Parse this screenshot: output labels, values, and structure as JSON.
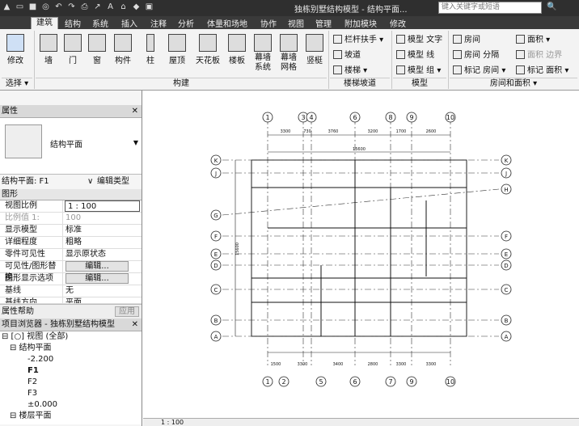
{
  "window": {
    "title": "独栋别墅结构模型 - 结构平面...",
    "search_placeholder": "键入关键字或短语"
  },
  "tabs": [
    "建筑",
    "结构",
    "系统",
    "插入",
    "注释",
    "分析",
    "体量和场地",
    "协作",
    "视图",
    "管理",
    "附加模块",
    "修改"
  ],
  "ribbon": {
    "modify": "修改",
    "select": "选择 ▾",
    "build": [
      "墙",
      "门",
      "窗",
      "构件",
      "柱",
      "屋顶",
      "天花板",
      "楼板",
      "幕墙系统",
      "幕墙网格",
      "竖梃"
    ],
    "build_group": "构建",
    "circ": [
      "栏杆扶手 ▾",
      "坡道",
      "楼梯 ▾"
    ],
    "circ_group": "楼梯坡道",
    "model": [
      "模型 文字",
      "模型 线",
      "模型 组 ▾"
    ],
    "model_group": "模型",
    "room": [
      "房间",
      "房间 分隔",
      "标记 房间 ▾",
      "面积 ▾",
      "面积 边界",
      "标记 面积 ▾"
    ],
    "room_group": "房间和面积 ▾"
  },
  "properties": {
    "header": "属性",
    "type_name": "结构平面",
    "selector": "结构平面: F1",
    "edit_type": "编辑类型",
    "section": "图形",
    "rows": [
      {
        "k": "视图比例",
        "v": "1 : 100"
      },
      {
        "k": "比例值 1:",
        "v": "100"
      },
      {
        "k": "显示模型",
        "v": "标准"
      },
      {
        "k": "详细程度",
        "v": "粗略"
      },
      {
        "k": "零件可见性",
        "v": "显示原状态"
      },
      {
        "k": "可见性/图形替换",
        "v": "编辑..."
      },
      {
        "k": "图形显示选项",
        "v": "编辑..."
      },
      {
        "k": "基线",
        "v": "无"
      },
      {
        "k": "基线方向",
        "v": "平面"
      }
    ],
    "help": "属性帮助",
    "apply": "应用"
  },
  "browser": {
    "header": "项目浏览器 - 独栋别墅结构模型",
    "items": [
      "⊟ [○] 视图 (全部)",
      "⊟ 结构平面",
      "-2.200",
      "F1",
      "F2",
      "F3",
      "±0.000",
      "⊟ 楼层平面"
    ]
  },
  "drawing": {
    "top_axes": [
      "1",
      "3",
      "4",
      "6",
      "8",
      "9",
      "10"
    ],
    "bottom_axes": [
      "1",
      "2",
      "5",
      "6",
      "7",
      "9",
      "10"
    ],
    "left_axes": [
      "K",
      "J",
      "G",
      "F",
      "E",
      "D",
      "C",
      "B",
      "A"
    ],
    "right_axes": [
      "K",
      "J",
      "H",
      "F",
      "E",
      "D",
      "C",
      "B",
      "A"
    ],
    "top_dims": [
      "3300",
      "730",
      "3760",
      "3200",
      "1700",
      "2600"
    ],
    "overall_top": "15600",
    "bottom_dims": [
      "1500",
      "3300",
      "3400",
      "2800",
      "3300",
      "3300"
    ],
    "left_dim": "15600"
  },
  "status": {
    "scale": "1 : 100"
  }
}
